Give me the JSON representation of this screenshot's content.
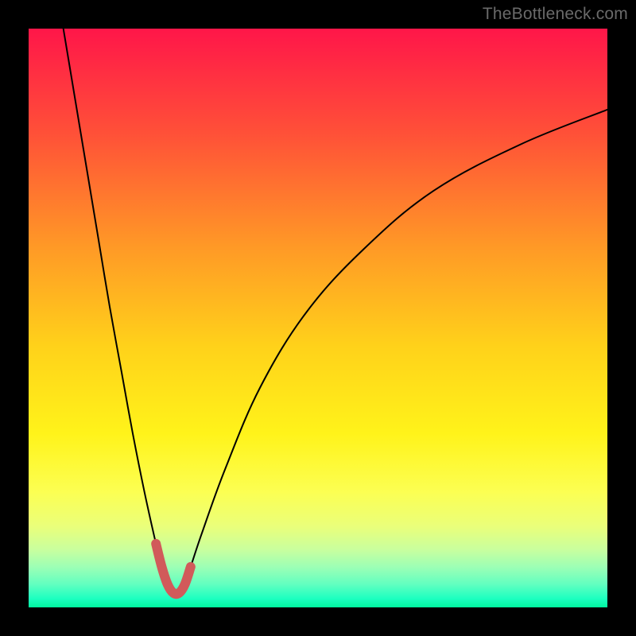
{
  "watermark": "TheBottleneck.com",
  "chart_data": {
    "type": "line",
    "title": "",
    "xlabel": "",
    "ylabel": "",
    "xlim": [
      0,
      100
    ],
    "ylim": [
      0,
      100
    ],
    "grid": false,
    "background": "rainbow_gradient_vertical",
    "series": [
      {
        "name": "bottleneck-curve",
        "color": "#000000",
        "x": [
          6,
          8,
          10,
          12,
          14,
          16,
          18,
          20,
          22,
          23,
          24,
          25,
          26,
          27,
          28,
          30,
          34,
          40,
          48,
          58,
          70,
          85,
          100
        ],
        "y": [
          100,
          88,
          76,
          64,
          52,
          41,
          30,
          20,
          11,
          7,
          4,
          2.5,
          2.5,
          4,
          7,
          13,
          24,
          38,
          51,
          62,
          72,
          80,
          86
        ]
      },
      {
        "name": "highlight-minimum",
        "color": "#d15a5a",
        "stroke_width_px": 12,
        "x": [
          22,
          23,
          24,
          25,
          26,
          27,
          28
        ],
        "y": [
          11,
          7,
          4,
          2.5,
          2.5,
          4,
          7
        ]
      }
    ]
  }
}
